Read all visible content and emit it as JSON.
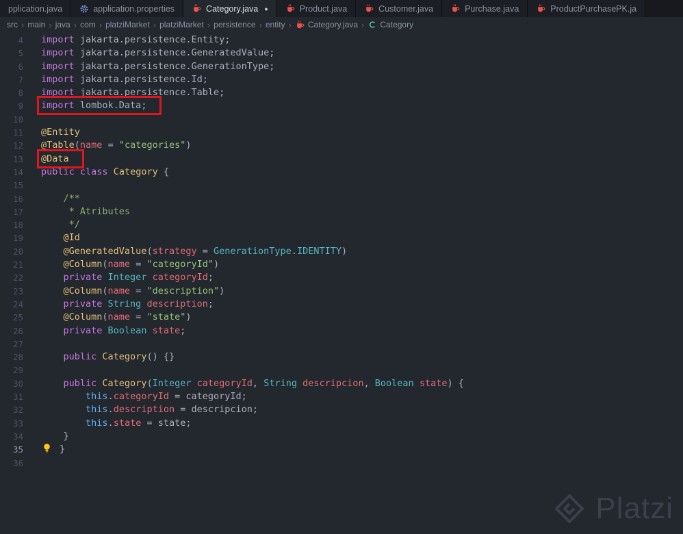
{
  "tabs": [
    {
      "label": "pplication.java",
      "icon": null,
      "active": false,
      "modified": false
    },
    {
      "label": "application.properties",
      "icon": "gear-icon",
      "active": false,
      "modified": false
    },
    {
      "label": "Category.java",
      "icon": "java-file-icon",
      "active": true,
      "modified": true
    },
    {
      "label": "Product.java",
      "icon": "java-file-icon",
      "active": false,
      "modified": false
    },
    {
      "label": "Customer.java",
      "icon": "java-file-icon",
      "active": false,
      "modified": false
    },
    {
      "label": "Purchase.java",
      "icon": "java-file-icon",
      "active": false,
      "modified": false
    },
    {
      "label": "ProductPurchasePK.ja",
      "icon": "java-file-icon",
      "active": false,
      "modified": false
    }
  ],
  "breadcrumb": {
    "items": [
      {
        "label": "src",
        "icon": null
      },
      {
        "label": "main",
        "icon": null
      },
      {
        "label": "java",
        "icon": null
      },
      {
        "label": "com",
        "icon": null
      },
      {
        "label": "platziMarket",
        "icon": null
      },
      {
        "label": "platziMarket",
        "icon": null
      },
      {
        "label": "persistence",
        "icon": null
      },
      {
        "label": "entity",
        "icon": null
      },
      {
        "label": "Category.java",
        "icon": "java-file-icon"
      },
      {
        "label": "Category",
        "icon": "class-symbol-icon"
      }
    ]
  },
  "editor": {
    "current_line": 35,
    "lines": [
      {
        "n": 4,
        "tokens": [
          [
            "kw",
            "import"
          ],
          [
            "def",
            " jakarta.persistence.Entity;"
          ]
        ]
      },
      {
        "n": 5,
        "tokens": [
          [
            "kw",
            "import"
          ],
          [
            "def",
            " jakarta.persistence.GeneratedValue;"
          ]
        ]
      },
      {
        "n": 6,
        "tokens": [
          [
            "kw",
            "import"
          ],
          [
            "def",
            " jakarta.persistence.GenerationType;"
          ]
        ]
      },
      {
        "n": 7,
        "tokens": [
          [
            "kw",
            "import"
          ],
          [
            "def",
            " jakarta.persistence.Id;"
          ]
        ]
      },
      {
        "n": 8,
        "tokens": [
          [
            "kw",
            "import"
          ],
          [
            "def",
            " jakarta.persistence.Table;"
          ]
        ]
      },
      {
        "n": 9,
        "tokens": [
          [
            "kw",
            "import"
          ],
          [
            "def",
            " lombok.Data;"
          ]
        ],
        "red_box": true
      },
      {
        "n": 10,
        "tokens": []
      },
      {
        "n": 11,
        "tokens": [
          [
            "ann",
            "@Entity"
          ]
        ]
      },
      {
        "n": 12,
        "tokens": [
          [
            "ann",
            "@Table"
          ],
          [
            "def",
            "("
          ],
          [
            "prop",
            "name"
          ],
          [
            "def",
            " = "
          ],
          [
            "str",
            "\"categories\""
          ],
          [
            "def",
            ")"
          ]
        ]
      },
      {
        "n": 13,
        "tokens": [
          [
            "ann",
            "@Data"
          ]
        ],
        "red_box": true
      },
      {
        "n": 14,
        "tokens": [
          [
            "kw",
            "public"
          ],
          [
            "def",
            " "
          ],
          [
            "kw",
            "class"
          ],
          [
            "def",
            " "
          ],
          [
            "cls",
            "Category"
          ],
          [
            "def",
            " {"
          ]
        ]
      },
      {
        "n": 15,
        "tokens": []
      },
      {
        "n": 16,
        "tokens": [
          [
            "com",
            "    /**"
          ]
        ]
      },
      {
        "n": 17,
        "tokens": [
          [
            "com",
            "     * Atributes"
          ]
        ]
      },
      {
        "n": 18,
        "tokens": [
          [
            "com",
            "     */"
          ]
        ]
      },
      {
        "n": 19,
        "tokens": [
          [
            "ann",
            "    @Id"
          ]
        ]
      },
      {
        "n": 20,
        "tokens": [
          [
            "ann",
            "    @GeneratedValue"
          ],
          [
            "def",
            "("
          ],
          [
            "prop",
            "strategy"
          ],
          [
            "def",
            " = "
          ],
          [
            "typ",
            "GenerationType"
          ],
          [
            "def",
            "."
          ],
          [
            "typ",
            "IDENTITY"
          ],
          [
            "def",
            ")"
          ]
        ]
      },
      {
        "n": 21,
        "tokens": [
          [
            "ann",
            "    @Column"
          ],
          [
            "def",
            "("
          ],
          [
            "prop",
            "name"
          ],
          [
            "def",
            " = "
          ],
          [
            "str",
            "\"categoryId\""
          ],
          [
            "def",
            ")"
          ]
        ]
      },
      {
        "n": 22,
        "tokens": [
          [
            "kw",
            "    private"
          ],
          [
            "def",
            " "
          ],
          [
            "typ",
            "Integer"
          ],
          [
            "def",
            " "
          ],
          [
            "prop",
            "categoryId"
          ],
          [
            "def",
            ";"
          ]
        ]
      },
      {
        "n": 23,
        "tokens": [
          [
            "ann",
            "    @Column"
          ],
          [
            "def",
            "("
          ],
          [
            "prop",
            "name"
          ],
          [
            "def",
            " = "
          ],
          [
            "str",
            "\"description\""
          ],
          [
            "def",
            ")"
          ]
        ]
      },
      {
        "n": 24,
        "tokens": [
          [
            "kw",
            "    private"
          ],
          [
            "def",
            " "
          ],
          [
            "typ",
            "String"
          ],
          [
            "def",
            " "
          ],
          [
            "prop",
            "description"
          ],
          [
            "def",
            ";"
          ]
        ]
      },
      {
        "n": 25,
        "tokens": [
          [
            "ann",
            "    @Column"
          ],
          [
            "def",
            "("
          ],
          [
            "prop",
            "name"
          ],
          [
            "def",
            " = "
          ],
          [
            "str",
            "\"state\""
          ],
          [
            "def",
            ")"
          ]
        ]
      },
      {
        "n": 26,
        "tokens": [
          [
            "kw",
            "    private"
          ],
          [
            "def",
            " "
          ],
          [
            "typ",
            "Boolean"
          ],
          [
            "def",
            " "
          ],
          [
            "prop",
            "state"
          ],
          [
            "def",
            ";"
          ]
        ]
      },
      {
        "n": 27,
        "tokens": []
      },
      {
        "n": 28,
        "tokens": [
          [
            "kw",
            "    public"
          ],
          [
            "def",
            " "
          ],
          [
            "cls",
            "Category"
          ],
          [
            "def",
            "() {}"
          ]
        ]
      },
      {
        "n": 29,
        "tokens": []
      },
      {
        "n": 30,
        "tokens": [
          [
            "kw",
            "    public"
          ],
          [
            "def",
            " "
          ],
          [
            "cls",
            "Category"
          ],
          [
            "def",
            "("
          ],
          [
            "typ",
            "Integer"
          ],
          [
            "def",
            " "
          ],
          [
            "prop",
            "categoryId"
          ],
          [
            "def",
            ", "
          ],
          [
            "typ",
            "String"
          ],
          [
            "def",
            " "
          ],
          [
            "prop",
            "descripcion"
          ],
          [
            "def",
            ", "
          ],
          [
            "typ",
            "Boolean"
          ],
          [
            "def",
            " "
          ],
          [
            "prop",
            "state"
          ],
          [
            "def",
            ") {"
          ]
        ]
      },
      {
        "n": 31,
        "tokens": [
          [
            "this",
            "        this"
          ],
          [
            "def",
            "."
          ],
          [
            "prop",
            "categoryId"
          ],
          [
            "def",
            " = categoryId;"
          ]
        ]
      },
      {
        "n": 32,
        "tokens": [
          [
            "this",
            "        this"
          ],
          [
            "def",
            "."
          ],
          [
            "prop",
            "description"
          ],
          [
            "def",
            " = descripcion;"
          ]
        ]
      },
      {
        "n": 33,
        "tokens": [
          [
            "this",
            "        this"
          ],
          [
            "def",
            "."
          ],
          [
            "prop",
            "state"
          ],
          [
            "def",
            " = state;"
          ]
        ]
      },
      {
        "n": 34,
        "tokens": [
          [
            "def",
            "    }"
          ]
        ]
      },
      {
        "n": 35,
        "tokens": [
          [
            "def",
            "}"
          ]
        ],
        "lightbulb": true
      },
      {
        "n": 36,
        "tokens": []
      }
    ]
  },
  "watermark": {
    "label": "Platzi"
  },
  "colors": {
    "java_icon": "#f0524a",
    "gear_icon": "#7a8fd4",
    "class_icon": "#4ec9b0",
    "lightbulb": "#ffc61a",
    "annotation_box": "#e0161f",
    "modified_dot": "#c9ced8"
  }
}
